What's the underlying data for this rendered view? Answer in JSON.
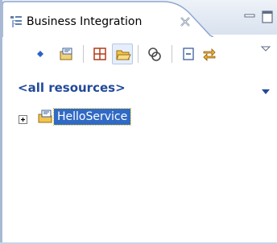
{
  "view": {
    "title": "Business Integration",
    "close_glyph": "×",
    "minimize_icon": "minimize-icon",
    "maximize_icon": "maximize-icon"
  },
  "toolbar": {
    "buttons": [
      {
        "name": "new-menu-button",
        "icon": "small-arrow-icon"
      },
      {
        "name": "new-module-button",
        "icon": "new-module-icon"
      },
      {
        "name": "show-by-category-button",
        "icon": "grid-icon"
      },
      {
        "name": "show-folders-button",
        "icon": "open-folder-icon",
        "pressed": true
      },
      {
        "name": "link-with-editor-button",
        "icon": "link-chain-icon"
      },
      {
        "name": "collapse-all-button",
        "icon": "collapse-all-icon"
      },
      {
        "name": "sync-button",
        "icon": "sync-arrows-icon"
      },
      {
        "name": "view-menu-button",
        "icon": "view-menu-icon"
      }
    ]
  },
  "filter": {
    "label": "<all resources>",
    "dropdown_icon": "dropdown-arrow-icon"
  },
  "tree": {
    "items": [
      {
        "label": "HelloService",
        "icon": "module-folder-icon",
        "expander": "+",
        "selected": true
      }
    ]
  },
  "colors": {
    "accent_blue": "#22499a",
    "selection": "#316ac5",
    "tab_border": "#8ea7cf"
  }
}
